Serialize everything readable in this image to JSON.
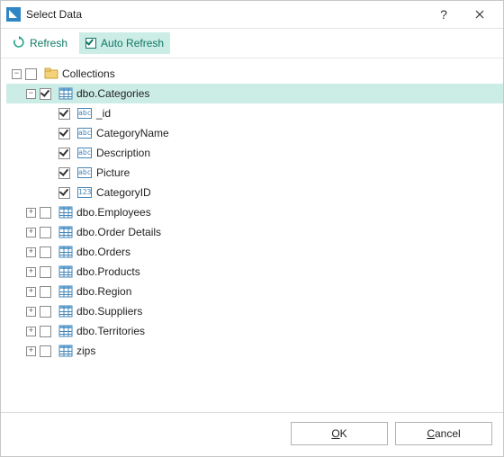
{
  "window": {
    "title": "Select Data"
  },
  "toolbar": {
    "refresh_label": "Refresh",
    "auto_refresh_label": "Auto Refresh"
  },
  "tree": {
    "root": {
      "label": "Collections",
      "expanded": true,
      "checked": false
    },
    "children": [
      {
        "label": "dbo.Categories",
        "checked": true,
        "expanded": true,
        "selected": true,
        "fields": [
          {
            "label": "_id",
            "type": "abc",
            "checked": true
          },
          {
            "label": "CategoryName",
            "type": "abc",
            "checked": true
          },
          {
            "label": "Description",
            "type": "abc",
            "checked": true
          },
          {
            "label": "Picture",
            "type": "abc",
            "checked": true
          },
          {
            "label": "CategoryID",
            "type": "123",
            "checked": true
          }
        ]
      },
      {
        "label": "dbo.Employees",
        "checked": false,
        "expanded": false
      },
      {
        "label": "dbo.Order Details",
        "checked": false,
        "expanded": false
      },
      {
        "label": "dbo.Orders",
        "checked": false,
        "expanded": false
      },
      {
        "label": "dbo.Products",
        "checked": false,
        "expanded": false
      },
      {
        "label": "dbo.Region",
        "checked": false,
        "expanded": false
      },
      {
        "label": "dbo.Suppliers",
        "checked": false,
        "expanded": false
      },
      {
        "label": "dbo.Territories",
        "checked": false,
        "expanded": false
      },
      {
        "label": "zips",
        "checked": false,
        "expanded": false
      }
    ]
  },
  "footer": {
    "ok_prefix": "O",
    "ok_rest": "K",
    "cancel_prefix": "C",
    "cancel_rest": "ancel"
  }
}
